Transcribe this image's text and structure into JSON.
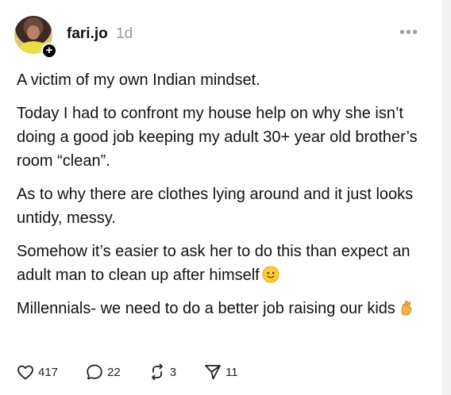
{
  "post": {
    "author": "fari.jo",
    "time": "1d",
    "more_icon": "ellipsis-icon",
    "paragraphs": [
      "A victim of my own Indian mindset.",
      "Today I had to confront my house help on why she isn’t doing a good job keeping my adult 30+ year old brother’s room “clean”.",
      "As to why there are clothes lying around and it just looks untidy, messy.",
      "Somehow it’s easier to ask her to do this than expect an adult man to clean up after himself",
      "Millennials- we need to do a better job raising our kids"
    ],
    "emojis": [
      "slightly-smiling-face",
      "crossed-fingers"
    ]
  },
  "actions": {
    "likes": "417",
    "replies": "22",
    "reposts": "3",
    "shares": "11"
  },
  "colors": {
    "text": "#111111",
    "muted": "#9a9a9a",
    "background": "#ffffff"
  }
}
